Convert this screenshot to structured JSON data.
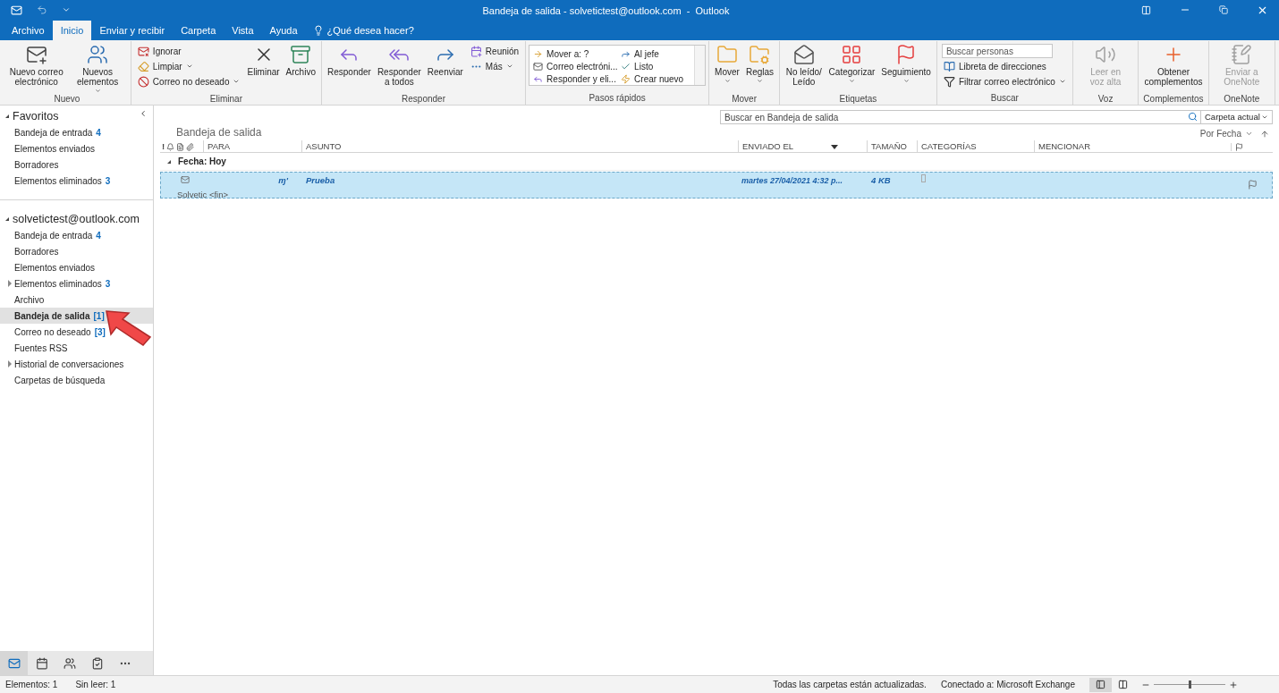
{
  "window": {
    "title": "Bandeja de salida - solvetictest@outlook.com  -  Outlook"
  },
  "tabs": [
    {
      "label": "Archivo",
      "selected": false
    },
    {
      "label": "Inicio",
      "selected": true
    },
    {
      "label": "Enviar y recibir",
      "selected": false
    },
    {
      "label": "Carpeta",
      "selected": false
    },
    {
      "label": "Vista",
      "selected": false
    },
    {
      "label": "Ayuda",
      "selected": false
    }
  ],
  "tell_me": {
    "placeholder": "¿Qué desea hacer?"
  },
  "ribbon": [
    {
      "label": "Nuevo",
      "items": [
        {
          "kind": "large",
          "label": "Nuevo correo electrónico",
          "dropdown": false,
          "disabled": false
        },
        {
          "kind": "large",
          "label": "Nuevos elementos",
          "dropdown": true,
          "disabled": false
        }
      ]
    },
    {
      "label": "Eliminar",
      "items": [
        {
          "kind": "small",
          "label": "Ignorar",
          "dropdown": false,
          "disabled": false
        },
        {
          "kind": "small",
          "label": "Limpiar",
          "dropdown": true,
          "disabled": false
        },
        {
          "kind": "small",
          "label": "Correo no deseado",
          "dropdown": true,
          "disabled": false
        },
        {
          "kind": "large",
          "label": "Eliminar",
          "dropdown": false,
          "disabled": false
        },
        {
          "kind": "large",
          "label": "Archivo",
          "dropdown": false,
          "disabled": false
        }
      ]
    },
    {
      "label": "Responder",
      "items": [
        {
          "kind": "large",
          "label": "Responder",
          "dropdown": false,
          "disabled": false
        },
        {
          "kind": "large",
          "label": "Responder a todos",
          "dropdown": false,
          "disabled": false
        },
        {
          "kind": "large",
          "label": "Reenviar",
          "dropdown": false,
          "disabled": false
        },
        {
          "kind": "small",
          "label": "Reunión",
          "dropdown": false,
          "disabled": false
        },
        {
          "kind": "small",
          "label": "Más",
          "dropdown": true,
          "disabled": false
        }
      ]
    },
    {
      "label": "Pasos rápidos",
      "items": [
        {
          "kind": "gallery",
          "label": "Mover a: ?",
          "disabled": false
        },
        {
          "kind": "gallery",
          "label": "Correo electróni...",
          "disabled": false
        },
        {
          "kind": "gallery",
          "label": "Responder y eli...",
          "disabled": false
        },
        {
          "kind": "gallery",
          "label": "Al jefe",
          "disabled": false
        },
        {
          "kind": "gallery",
          "label": "Listo",
          "disabled": false
        },
        {
          "kind": "gallery",
          "label": "Crear nuevo",
          "disabled": false
        }
      ]
    },
    {
      "label": "Mover",
      "items": [
        {
          "kind": "large",
          "label": "Mover",
          "dropdown": true,
          "disabled": false
        },
        {
          "kind": "large",
          "label": "Reglas",
          "dropdown": true,
          "disabled": false
        }
      ]
    },
    {
      "label": "Etiquetas",
      "items": [
        {
          "kind": "large",
          "label": "No leído/ Leído",
          "dropdown": false,
          "disabled": false
        },
        {
          "kind": "large",
          "label": "Categorizar",
          "dropdown": true,
          "disabled": false
        },
        {
          "kind": "large",
          "label": "Seguimiento",
          "dropdown": true,
          "disabled": false
        }
      ]
    },
    {
      "label": "Buscar",
      "items": [
        {
          "kind": "search",
          "placeholder": "Buscar personas"
        },
        {
          "kind": "small",
          "label": "Libreta de direcciones",
          "dropdown": false,
          "disabled": false
        },
        {
          "kind": "small",
          "label": "Filtrar correo electrónico",
          "dropdown": true,
          "disabled": false
        }
      ]
    },
    {
      "label": "Voz",
      "items": [
        {
          "kind": "large",
          "label": "Leer en voz alta",
          "dropdown": false,
          "disabled": true
        }
      ]
    },
    {
      "label": "Complementos",
      "items": [
        {
          "kind": "large",
          "label": "Obtener complementos",
          "dropdown": false,
          "disabled": false
        }
      ]
    },
    {
      "label": "OneNote",
      "items": [
        {
          "kind": "large",
          "label": "Enviar a OneNote",
          "dropdown": false,
          "disabled": true
        }
      ]
    }
  ],
  "sidebar": [
    {
      "title": "Favoritos",
      "items": [
        {
          "label": "Bandeja de entrada",
          "count": "4",
          "expandable": false,
          "selected": false
        },
        {
          "label": "Elementos enviados",
          "expandable": false,
          "selected": false
        },
        {
          "label": "Borradores",
          "expandable": false,
          "selected": false
        },
        {
          "label": "Elementos eliminados",
          "count": "3",
          "expandable": false,
          "selected": false
        }
      ]
    },
    {
      "title": "solvetictest@outlook.com",
      "items": [
        {
          "label": "Bandeja de entrada",
          "count": "4",
          "expandable": false,
          "selected": false
        },
        {
          "label": "Borradores",
          "expandable": false,
          "selected": false
        },
        {
          "label": "Elementos enviados",
          "expandable": false,
          "selected": false
        },
        {
          "label": "Elementos eliminados",
          "count": "3",
          "expandable": true,
          "selected": false
        },
        {
          "label": "Archivo",
          "expandable": false,
          "selected": false
        },
        {
          "label": "Bandeja de salida",
          "count": "[1]",
          "expandable": false,
          "selected": true
        },
        {
          "label": "Correo no deseado",
          "count": "[3]",
          "expandable": false,
          "selected": false
        },
        {
          "label": "Fuentes RSS",
          "expandable": false,
          "selected": false
        },
        {
          "label": "Historial de conversaciones",
          "expandable": true,
          "selected": false
        },
        {
          "label": "Carpetas de búsqueda",
          "expandable": false,
          "selected": false
        }
      ]
    }
  ],
  "nav": [
    {
      "kind": "mail",
      "selected": true
    },
    {
      "kind": "calendar",
      "selected": false
    },
    {
      "kind": "people",
      "selected": false
    },
    {
      "kind": "tasks",
      "selected": false
    },
    {
      "kind": "more",
      "selected": false
    }
  ],
  "search": {
    "placeholder": "Buscar en Bandeja de salida",
    "scope": "Carpeta actual"
  },
  "folder_title": "Bandeja de salida",
  "sort": "Por Fecha",
  "importance_header": "!",
  "columns": [
    "PARA",
    "ASUNTO",
    "ENVIADO EL",
    "TAMAÑO",
    "CATEGORÍAS",
    "MENCIONAR"
  ],
  "group_header": "Fecha: Hoy",
  "messages": [
    {
      "to": "ɱ'",
      "subject": "Prueba",
      "sent": "martes 27/04/2021 4:32 p...",
      "size": "4 KB",
      "preview": "Solvetic <fin>",
      "selected": true
    }
  ],
  "status_bar": {
    "items": "Elementos: 1",
    "unread": "Sin leer: 1",
    "sync": "Todas las carpetas están actualizadas.",
    "connection": "Conectado a: Microsoft Exchange",
    "zoom": {
      "level": 0.5
    }
  }
}
